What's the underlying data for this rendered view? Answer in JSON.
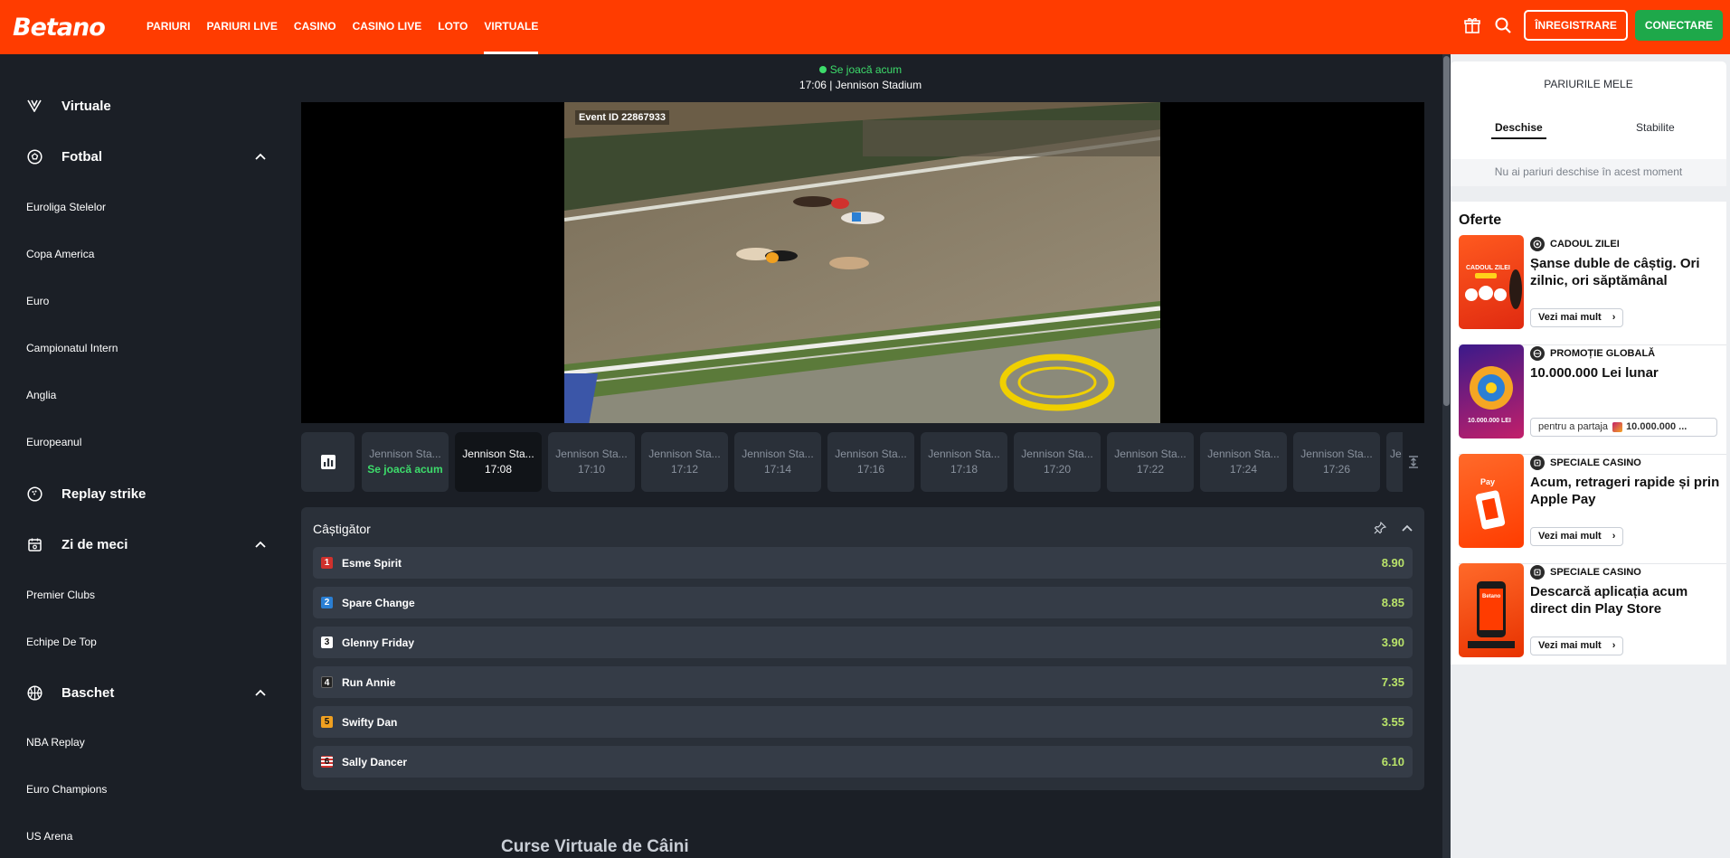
{
  "brand": {
    "logo": "Betano"
  },
  "nav": [
    {
      "label": "PARIURI",
      "active": false
    },
    {
      "label": "PARIURI LIVE",
      "active": false
    },
    {
      "label": "CASINO",
      "active": false
    },
    {
      "label": "CASINO LIVE",
      "active": false
    },
    {
      "label": "LOTO",
      "active": false
    },
    {
      "label": "VIRTUALE",
      "active": true
    }
  ],
  "topright": {
    "register": "ÎNREGISTRARE",
    "login": "CONECTARE"
  },
  "sidebar": {
    "virtuale": "Virtuale",
    "fotbal": "Fotbal",
    "fotbal_items": [
      "Euroliga Stelelor",
      "Copa America",
      "Euro",
      "Campionatul Intern",
      "Anglia",
      "Europeanul"
    ],
    "replay": "Replay strike",
    "zi": "Zi de meci",
    "zi_items": [
      "Premier Clubs",
      "Echipe De Top"
    ],
    "baschet": "Baschet",
    "baschet_items": [
      "NBA Replay",
      "Euro Champions",
      "US Arena"
    ]
  },
  "event": {
    "status": "Se joacă acum",
    "stadium": "17:06 | Jennison Stadium",
    "event_id": "Event ID 22867933"
  },
  "races": [
    {
      "name": "Jennison Sta...",
      "time": "Se joacă acum",
      "state": "live"
    },
    {
      "name": "Jennison Sta...",
      "time": "17:08",
      "state": "selected"
    },
    {
      "name": "Jennison Sta...",
      "time": "17:10",
      "state": "normal"
    },
    {
      "name": "Jennison Sta...",
      "time": "17:12",
      "state": "normal"
    },
    {
      "name": "Jennison Sta...",
      "time": "17:14",
      "state": "normal"
    },
    {
      "name": "Jennison Sta...",
      "time": "17:16",
      "state": "normal"
    },
    {
      "name": "Jennison Sta...",
      "time": "17:18",
      "state": "normal"
    },
    {
      "name": "Jennison Sta...",
      "time": "17:20",
      "state": "normal"
    },
    {
      "name": "Jennison Sta...",
      "time": "17:22",
      "state": "normal"
    },
    {
      "name": "Jennison Sta...",
      "time": "17:24",
      "state": "normal"
    },
    {
      "name": "Jennison Sta...",
      "time": "17:26",
      "state": "normal"
    }
  ],
  "race_partial": "Je",
  "market": {
    "title": "Câștigător",
    "runners": [
      {
        "trap": "1",
        "name": "Esme Spirit",
        "odds": "8.90",
        "bg": "#d0312d",
        "fg": "#ffffff"
      },
      {
        "trap": "2",
        "name": "Spare Change",
        "odds": "8.85",
        "bg": "#2a7fd4",
        "fg": "#ffffff"
      },
      {
        "trap": "3",
        "name": "Glenny Friday",
        "odds": "3.90",
        "bg": "#ffffff",
        "fg": "#111111"
      },
      {
        "trap": "4",
        "name": "Run Annie",
        "odds": "7.35",
        "bg": "#222222",
        "fg": "#ffffff"
      },
      {
        "trap": "5",
        "name": "Swifty Dan",
        "odds": "3.55",
        "bg": "#f0a020",
        "fg": "#111111"
      },
      {
        "trap": "6",
        "name": "Sally Dancer",
        "odds": "6.10",
        "bg": "#d0312d",
        "fg": "#ffffff"
      }
    ]
  },
  "page_heading": "Curse Virtuale de Câini",
  "my_bets": {
    "title": "PARIURILE MELE",
    "tab_open": "Deschise",
    "tab_settled": "Stabilite",
    "empty": "Nu ai pariuri deschise în acest moment"
  },
  "offers": {
    "title": "Oferte",
    "items": [
      {
        "category": "CADOUL ZILEI",
        "title": "Șanse duble de câștig. Ori zilnic, ori săptămânal",
        "button": "Vezi mai mult"
      },
      {
        "category": "PROMOȚIE GLOBALĂ",
        "title": "10.000.000 Lei lunar",
        "button_prefix": "pentru a partaja",
        "button_value": "10.000.000 ..."
      },
      {
        "category": "SPECIALE CASINO",
        "title": "Acum, retrageri rapide și prin Apple Pay",
        "button": "Vezi mai mult"
      },
      {
        "category": "SPECIALE CASINO",
        "title": "Descarcă aplicația acum direct din Play Store",
        "button": "Vezi mai mult"
      }
    ]
  },
  "colors": {
    "brand": "#ff3c00",
    "green": "#1ea84a",
    "live": "#3ddc6b",
    "odds": "#b9e36a"
  }
}
